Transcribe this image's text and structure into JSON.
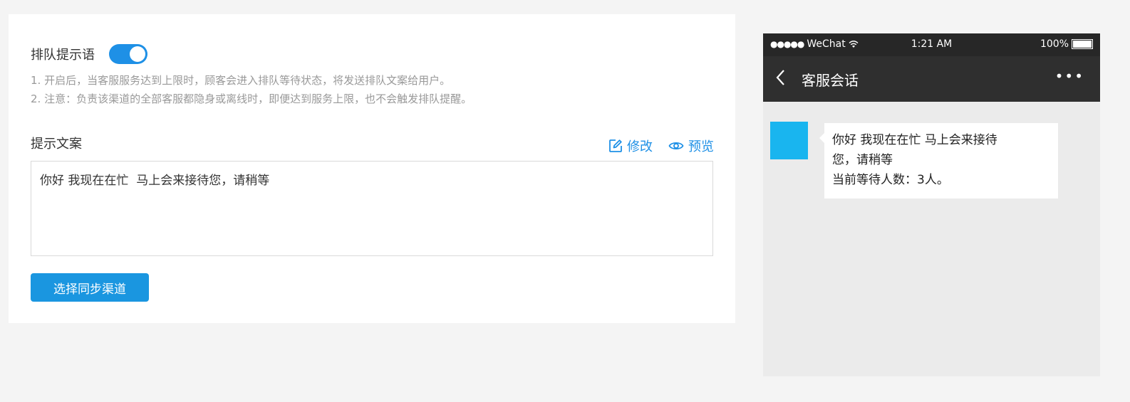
{
  "settings": {
    "toggle_label": "排队提示语",
    "toggle_on": true,
    "description_lines": [
      "1. 开启后，当客服服务达到上限时，顾客会进入排队等待状态，将发送排队文案给用户。",
      "2. 注意：负责该渠道的全部客服都隐身或离线时，即便达到服务上限，也不会触发排队提醒。"
    ],
    "copy_label": "提示文案",
    "edit_label": "修改",
    "preview_label": "预览",
    "copy_text": "你好 我现在在忙  马上会来接待您，请稍等",
    "sync_button_label": "选择同步渠道"
  },
  "phone": {
    "status": {
      "carrier": "WeChat",
      "time": "1:21 AM",
      "battery": "100%"
    },
    "nav_title": "客服会话",
    "bubble_lines": [
      "你好 我现在在忙 马上会来接待",
      "您，请稍等",
      "当前等待人数：3人。"
    ]
  },
  "colors": {
    "accent": "#1e90e6",
    "avatar": "#19b5ef",
    "phone_header": "#2f2f2f"
  }
}
